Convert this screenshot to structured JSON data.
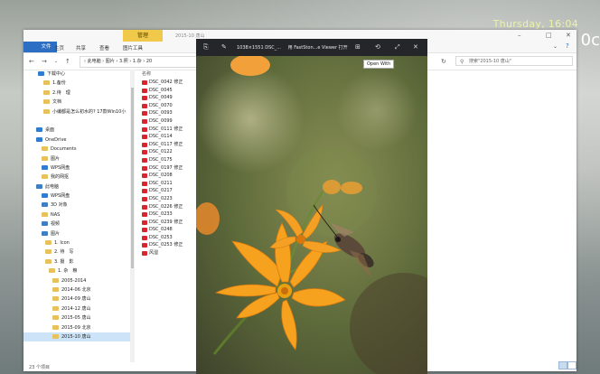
{
  "desktop": {
    "clock": "Thursday, 16:04",
    "edge_text": "0c"
  },
  "explorer": {
    "title_badge": "管理",
    "title_text": "2015-10 唐山",
    "ribbon": {
      "file": "文件",
      "tabs": [
        "主页",
        "共享",
        "查看",
        "图片工具"
      ]
    },
    "address": "› 此电脑 › 图片 › 3.照 › 1.杂 › 20",
    "search_placeholder": "搜索\"2015-10 唐山\"",
    "nav_items": [
      {
        "label": "下载中心",
        "color": "#2f7dd3"
      },
      {
        "label": "1.备份",
        "color": "#e8c15a"
      },
      {
        "label": "2.待　理",
        "color": "#e8c15a"
      },
      {
        "label": "文档",
        "color": "#e8c15a"
      },
      {
        "label": "小编都是怎么初水的? 17款Win10小",
        "color": "#e8c15a"
      },
      {
        "label": "",
        "color": "transparent"
      },
      {
        "label": "桌面",
        "color": "#2f7dd3"
      },
      {
        "label": "OneDrive",
        "color": "#2f7dd3"
      },
      {
        "label": "Documents",
        "color": "#e8c15a"
      },
      {
        "label": "图片",
        "color": "#e8c15a"
      },
      {
        "label": "WPS网盘",
        "color": "#2f7dd3"
      },
      {
        "label": "我的网抠",
        "color": "#e8c15a"
      },
      {
        "label": "此电脑",
        "color": "#3d7fc4"
      },
      {
        "label": "WPS网盘",
        "color": "#2f7dd3"
      },
      {
        "label": "3D 对象",
        "color": "#3d7fc4"
      },
      {
        "label": "NAS",
        "color": "#e8c15a"
      },
      {
        "label": "视频",
        "color": "#3d7fc4"
      },
      {
        "label": "图片",
        "color": "#3d7fc4"
      },
      {
        "label": "1. Icon",
        "color": "#e8c15a"
      },
      {
        "label": "2. 待　写",
        "color": "#e8c15a"
      },
      {
        "label": "3. 摄　影",
        "color": "#e8c15a"
      },
      {
        "label": "1. 杂　粮",
        "color": "#e8c15a"
      },
      {
        "label": "2005-2014",
        "color": "#e8c15a"
      },
      {
        "label": "2014-06 北京",
        "color": "#e8c15a"
      },
      {
        "label": "2014-09 唐山",
        "color": "#e8c15a"
      },
      {
        "label": "2014-12 唐山",
        "color": "#e8c15a"
      },
      {
        "label": "2015-05 唐山",
        "color": "#e8c15a"
      },
      {
        "label": "2015-09 北京",
        "color": "#e8c15a"
      },
      {
        "label": "2015-10 唐山",
        "color": "#e8c15a",
        "selected": true
      }
    ],
    "column_header": "名称",
    "files": [
      "DSC_0042 修正",
      "DSC_0045",
      "DSC_0049",
      "DSC_0070",
      "DSC_0093",
      "DSC_0099",
      "DSC_0111 修正",
      "DSC_0114",
      "DSC_0117 修正",
      "DSC_0122",
      "DSC_0175",
      "DSC_0197 修正",
      "DSC_0208",
      "DSC_0211",
      "DSC_0217",
      "DSC_0223",
      "DSC_0226 修正",
      "DSC_0233",
      "DSC_0239 修正",
      "DSC_0248",
      "DSC_0253",
      "DSC_0253 修正",
      "风湿"
    ],
    "status": "23 个项目"
  },
  "viewer": {
    "title": "1038×1551  DSC_...",
    "open_with": "用 FastSton...e Viewer 打开",
    "tooltip": "Open With"
  }
}
